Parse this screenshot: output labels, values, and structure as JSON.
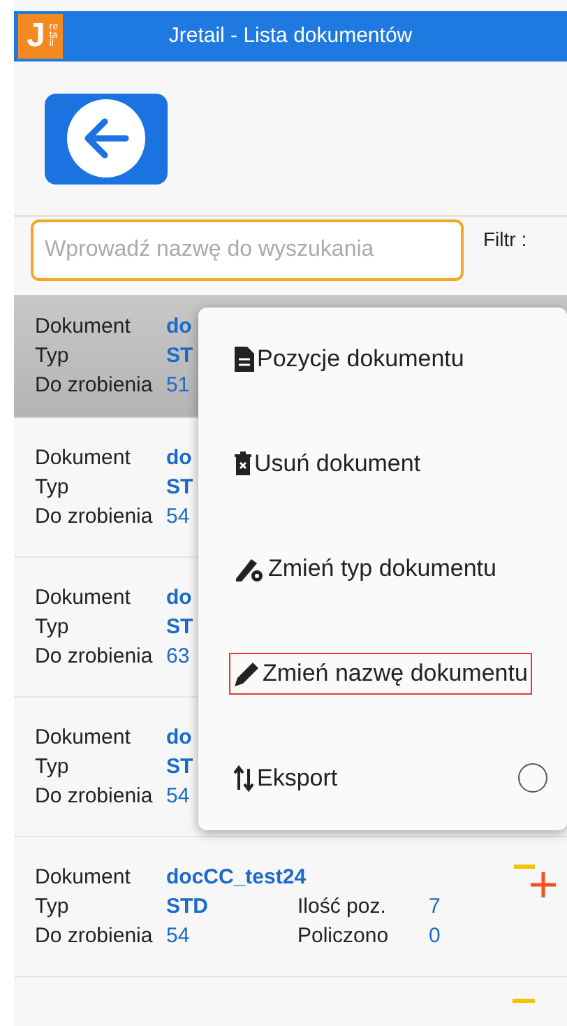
{
  "title_bar": {
    "logo": "J",
    "logo_sub": "retail",
    "title": "Jretail - Lista dokumentów"
  },
  "search": {
    "placeholder": "Wprowadź nazwę do wyszukania",
    "filter_label": "Filtr :"
  },
  "documents": [
    {
      "selected": true,
      "document_label": "Dokument",
      "document": "do",
      "type_label": "Typ",
      "type": "ST",
      "to_do_label": "Do zrobienia",
      "to_do": "51"
    },
    {
      "selected": false,
      "document_label": "Dokument",
      "document": "do",
      "type_label": "Typ",
      "type": "ST",
      "to_do_label": "Do zrobienia",
      "to_do": "54"
    },
    {
      "selected": false,
      "document_label": "Dokument",
      "document": "do",
      "type_label": "Typ",
      "type": "ST",
      "to_do_label": "Do zrobienia",
      "to_do": "63"
    },
    {
      "selected": false,
      "document_label": "Dokument",
      "document": "do",
      "type_label": "Typ",
      "type": "ST",
      "to_do_label": "Do zrobienia",
      "to_do": "54"
    },
    {
      "selected": false,
      "document_label": "Dokument",
      "document": "docCC_test24",
      "type_label": "Typ",
      "type": "STD",
      "to_do_label": "Do zrobienia",
      "to_do": "54",
      "positions_label": "Ilość poz.",
      "positions": "7",
      "counted_label": "Policzono",
      "counted": "0"
    }
  ],
  "context_menu": {
    "items": [
      {
        "kind": "document",
        "label": "Pozycje dokumentu",
        "selected": false
      },
      {
        "kind": "delete",
        "label": "Usuń dokument",
        "selected": false
      },
      {
        "kind": "type",
        "label": "Zmień typ dokumentu",
        "selected": false
      },
      {
        "kind": "rename",
        "label": "Zmień nazwę dokumentu",
        "selected": true
      },
      {
        "kind": "export",
        "label": "Eksport",
        "selected": false,
        "checked": false
      }
    ]
  }
}
